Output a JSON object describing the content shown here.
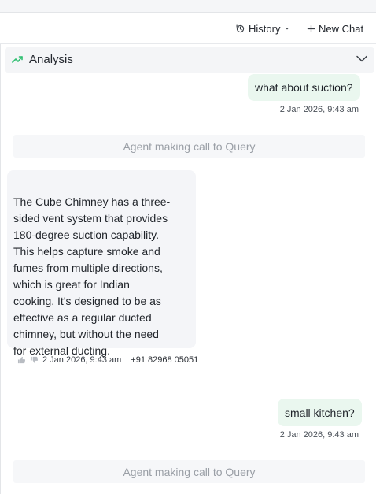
{
  "toolbar": {
    "history_label": "History",
    "new_chat_label": "New Chat"
  },
  "analysis": {
    "label": "Analysis",
    "accent": "#2fbf71"
  },
  "messages": [
    {
      "role": "user",
      "text": "what about suction?",
      "timestamp": "2 Jan 2026, 9:43 am"
    },
    {
      "role": "system",
      "text": "Agent making call to Query"
    },
    {
      "role": "assistant",
      "text": "The Cube Chimney has a three-\nsided vent system that provides\n180-degree suction capability.\nThis helps capture smoke and\nfumes from multiple directions,\nwhich is great for Indian\ncooking. It's designed to be as\neffective as a regular ducted\nchimney, but without the need\nfor external ducting.",
      "timestamp": "2 Jan 2026, 9:43 am",
      "phone": "+91 82968 05051"
    },
    {
      "role": "user",
      "text": "small kitchen?",
      "timestamp": "2 Jan 2026, 9:43 am"
    },
    {
      "role": "system",
      "text": "Agent making call to Query"
    }
  ],
  "colors": {
    "user_bubble": "#eaf7ef",
    "bot_bubble": "#f4f5f8",
    "system_bar": "#f6f7f9"
  }
}
